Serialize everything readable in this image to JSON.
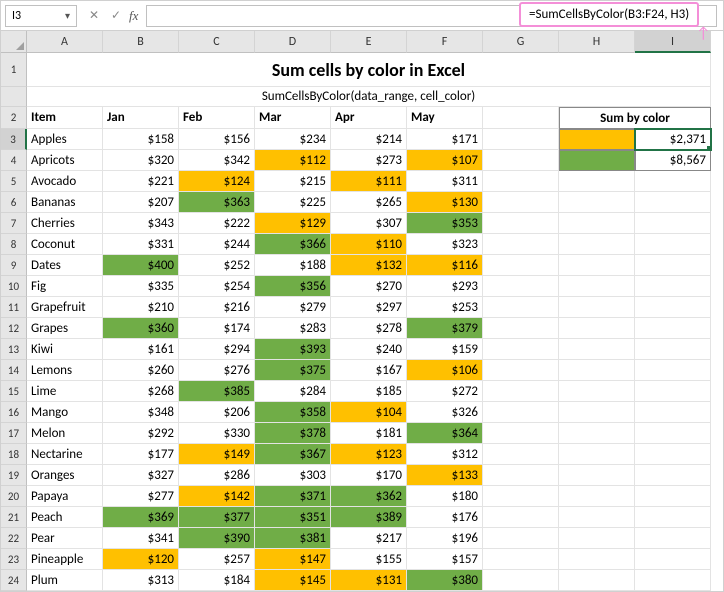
{
  "callout_formula": "=SumCellsByColor(B3:F24, H3)",
  "namebox": "I3",
  "title": "Sum cells by color in Excel",
  "subtitle": "SumCellsByColor(data_range, cell_color)",
  "columns": [
    "A",
    "B",
    "C",
    "D",
    "E",
    "F",
    "G",
    "H",
    "I"
  ],
  "months": [
    "Jan",
    "Feb",
    "Mar",
    "Apr",
    "May"
  ],
  "item_header": "Item",
  "sum_header": "Sum by color",
  "sum_results": [
    "$2,371",
    "$8,567"
  ],
  "sum_colors": [
    "orange",
    "green"
  ],
  "rows": [
    {
      "r": 3,
      "item": "Apples",
      "v": [
        "$158",
        "$156",
        "$234",
        "$214",
        "$171"
      ],
      "c": [
        "",
        "",
        "",
        "",
        ""
      ]
    },
    {
      "r": 4,
      "item": "Apricots",
      "v": [
        "$320",
        "$342",
        "$112",
        "$273",
        "$107"
      ],
      "c": [
        "",
        "",
        "orange",
        "",
        "orange"
      ]
    },
    {
      "r": 5,
      "item": "Avocado",
      "v": [
        "$221",
        "$124",
        "$215",
        "$111",
        "$311"
      ],
      "c": [
        "",
        "orange",
        "",
        "orange",
        ""
      ]
    },
    {
      "r": 6,
      "item": "Bananas",
      "v": [
        "$207",
        "$363",
        "$225",
        "$265",
        "$130"
      ],
      "c": [
        "",
        "green",
        "",
        "",
        "orange"
      ]
    },
    {
      "r": 7,
      "item": "Cherries",
      "v": [
        "$343",
        "$222",
        "$129",
        "$307",
        "$353"
      ],
      "c": [
        "",
        "",
        "orange",
        "",
        "green"
      ]
    },
    {
      "r": 8,
      "item": "Coconut",
      "v": [
        "$331",
        "$244",
        "$366",
        "$110",
        "$323"
      ],
      "c": [
        "",
        "",
        "green",
        "orange",
        ""
      ]
    },
    {
      "r": 9,
      "item": "Dates",
      "v": [
        "$400",
        "$252",
        "$188",
        "$132",
        "$116"
      ],
      "c": [
        "green",
        "",
        "",
        "orange",
        "orange"
      ]
    },
    {
      "r": 10,
      "item": "Fig",
      "v": [
        "$335",
        "$254",
        "$356",
        "$270",
        "$293"
      ],
      "c": [
        "",
        "",
        "green",
        "",
        ""
      ]
    },
    {
      "r": 11,
      "item": "Grapefruit",
      "v": [
        "$210",
        "$216",
        "$279",
        "$297",
        "$253"
      ],
      "c": [
        "",
        "",
        "",
        "",
        ""
      ]
    },
    {
      "r": 12,
      "item": "Grapes",
      "v": [
        "$360",
        "$174",
        "$283",
        "$278",
        "$379"
      ],
      "c": [
        "green",
        "",
        "",
        "",
        "green"
      ]
    },
    {
      "r": 13,
      "item": "Kiwi",
      "v": [
        "$161",
        "$294",
        "$393",
        "$240",
        "$159"
      ],
      "c": [
        "",
        "",
        "green",
        "",
        ""
      ]
    },
    {
      "r": 14,
      "item": "Lemons",
      "v": [
        "$260",
        "$276",
        "$375",
        "$167",
        "$106"
      ],
      "c": [
        "",
        "",
        "green",
        "",
        "orange"
      ]
    },
    {
      "r": 15,
      "item": "Lime",
      "v": [
        "$268",
        "$385",
        "$284",
        "$185",
        "$272"
      ],
      "c": [
        "",
        "green",
        "",
        "",
        ""
      ]
    },
    {
      "r": 16,
      "item": "Mango",
      "v": [
        "$348",
        "$206",
        "$358",
        "$104",
        "$326"
      ],
      "c": [
        "",
        "",
        "green",
        "orange",
        ""
      ]
    },
    {
      "r": 17,
      "item": "Melon",
      "v": [
        "$292",
        "$330",
        "$378",
        "$181",
        "$364"
      ],
      "c": [
        "",
        "",
        "green",
        "",
        "green"
      ]
    },
    {
      "r": 18,
      "item": "Nectarine",
      "v": [
        "$177",
        "$149",
        "$367",
        "$123",
        "$312"
      ],
      "c": [
        "",
        "orange",
        "green",
        "orange",
        ""
      ]
    },
    {
      "r": 19,
      "item": "Oranges",
      "v": [
        "$327",
        "$286",
        "$303",
        "$170",
        "$133"
      ],
      "c": [
        "",
        "",
        "",
        "",
        "orange"
      ]
    },
    {
      "r": 20,
      "item": "Papaya",
      "v": [
        "$277",
        "$142",
        "$371",
        "$362",
        "$180"
      ],
      "c": [
        "",
        "orange",
        "green",
        "green",
        ""
      ]
    },
    {
      "r": 21,
      "item": "Peach",
      "v": [
        "$369",
        "$377",
        "$351",
        "$389",
        "$176"
      ],
      "c": [
        "green",
        "green",
        "green",
        "green",
        ""
      ]
    },
    {
      "r": 22,
      "item": "Pear",
      "v": [
        "$341",
        "$390",
        "$381",
        "$217",
        "$196"
      ],
      "c": [
        "",
        "green",
        "green",
        "",
        ""
      ]
    },
    {
      "r": 23,
      "item": "Pineapple",
      "v": [
        "$120",
        "$257",
        "$147",
        "$155",
        "$157"
      ],
      "c": [
        "orange",
        "",
        "orange",
        "",
        ""
      ]
    },
    {
      "r": 24,
      "item": "Plum",
      "v": [
        "$313",
        "$184",
        "$145",
        "$131",
        "$380"
      ],
      "c": [
        "",
        "",
        "orange",
        "orange",
        "green"
      ]
    }
  ]
}
